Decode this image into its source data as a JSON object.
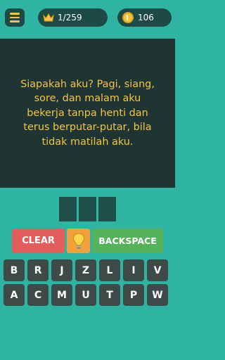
{
  "header": {
    "menu_icon": "hamburger-menu-icon",
    "level_icon": "crown-icon",
    "level_text": "1/259",
    "coin_icon": "coin-icon",
    "coins_text": "106"
  },
  "question": {
    "lines": [
      "Siapakah aku? Pagi, siang,",
      "sore, dan malam aku",
      "bekerja tanpa henti dan",
      "terus berputar-putar, bila",
      "tidak matilah aku."
    ]
  },
  "answer": {
    "slots": [
      "",
      "",
      ""
    ]
  },
  "actions": {
    "clear_label": "CLEAR",
    "hint_icon": "lightbulb-icon",
    "backspace_label": "BACKSPACE"
  },
  "keyboard": {
    "rows": [
      [
        "B",
        "R",
        "J",
        "Z",
        "L",
        "I",
        "V"
      ],
      [
        "A",
        "C",
        "M",
        "U",
        "T",
        "P",
        "W"
      ]
    ]
  },
  "colors": {
    "background": "#2fb3a3",
    "panel": "#1f3533",
    "accent_text": "#f5c542",
    "clear": "#e35d5d",
    "hint": "#f3a13a",
    "backspace": "#56b25a",
    "key": "#3d4a48"
  }
}
